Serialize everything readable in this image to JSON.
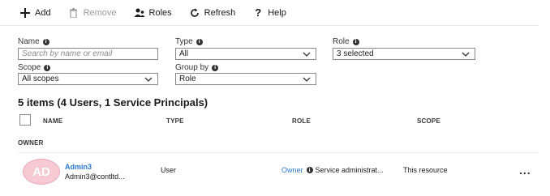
{
  "toolbar": {
    "add_label": "Add",
    "remove_label": "Remove",
    "roles_label": "Roles",
    "refresh_label": "Refresh",
    "help_label": "Help"
  },
  "filters": {
    "name": {
      "label": "Name",
      "placeholder": "Search by name or email"
    },
    "type": {
      "label": "Type",
      "value": "All"
    },
    "role": {
      "label": "Role",
      "value": "3 selected"
    },
    "scope": {
      "label": "Scope",
      "value": "All scopes"
    },
    "group_by": {
      "label": "Group by",
      "value": "Role"
    }
  },
  "summary": "5 items (4 Users, 1 Service Principals)",
  "table": {
    "headers": {
      "name": "NAME",
      "type": "TYPE",
      "role": "ROLE",
      "scope": "SCOPE"
    },
    "group_label": "OWNER",
    "rows": [
      {
        "initials": "AD",
        "name": "Admin3",
        "email": "Admin3@contltd...",
        "type": "User",
        "role": "Owner",
        "role_note": "Service administrat...",
        "scope": "This resource",
        "more": "..."
      }
    ]
  },
  "colors": {
    "accent": "#2a7ac8",
    "avatar_bg": "#f7c9d3"
  }
}
